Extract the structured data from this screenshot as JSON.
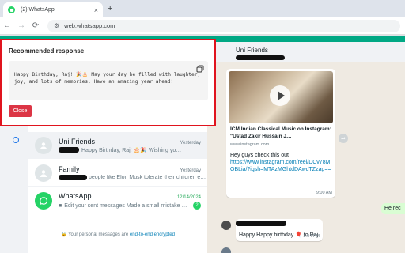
{
  "browser": {
    "tab_title": "(2) WhatsApp",
    "tab_close": "×",
    "new_tab": "+",
    "back": "←",
    "forward": "→",
    "reload": "⟳",
    "site_info": "⚙",
    "url": "web.whatsapp.com"
  },
  "popup": {
    "title": "Recommended response",
    "response_text": "Happy Birthday, Raj! 🎉🎂 May your day be filled with laughter, joy, and lots of memories. Have an amazing year ahead!",
    "close_label": "Close"
  },
  "chats": [
    {
      "name": "Uni Friends",
      "time": "Yesterday",
      "preview": "Happy Birthday, Raj! 🎂🎉 Wishing yo…",
      "avatar": "group-icon"
    },
    {
      "name": "Family",
      "time": "Yesterday",
      "preview": "people like Elon Musk tolerate their children e…",
      "avatar": "group-icon"
    },
    {
      "name": "WhatsApp",
      "time": "12/14/2024",
      "preview": "Edit your sent messages Made a small mistake …",
      "unread": "2",
      "avatar": "whatsapp-icon"
    }
  ],
  "encryption_note": {
    "prefix": "🔒 Your personal messages are ",
    "link": "end-to-end encrypted"
  },
  "conversation": {
    "title": "Uni Friends",
    "link_card": {
      "title": "ICM Indian Classical Music on Instagram: \"Ustad Zakir Hussain J…",
      "domain": "www.instagram.com",
      "message": "Hey guys check this out",
      "link": "https://www.instagram.com/reel/DCv78MOBLia/?igsh=MTAzMGhtdDAwdTZzag==",
      "time": "9:00 AM"
    },
    "outgoing_text": "He rec",
    "incoming": {
      "text": "Happy Happy birthday 🎈 to Raj",
      "time": "2:04 PM"
    }
  },
  "colors": {
    "accent": "#00a884",
    "highlight_border": "#e0141e",
    "close_button": "#dc3545",
    "link": "#027eb5"
  }
}
